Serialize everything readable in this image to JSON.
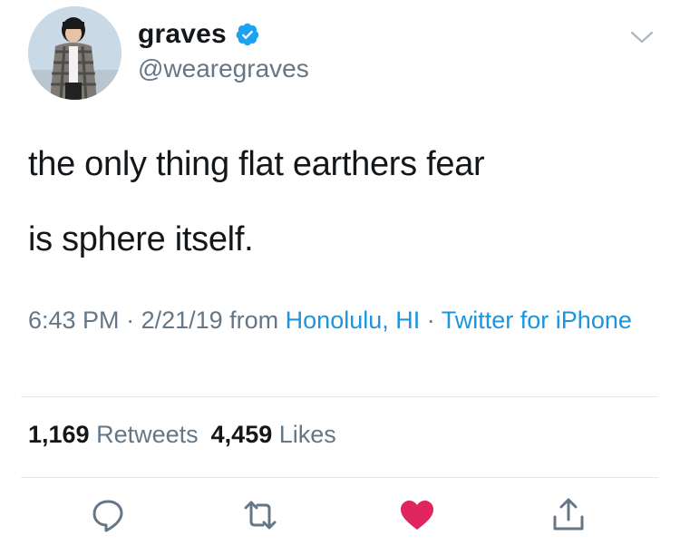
{
  "user": {
    "display_name": "graves",
    "handle": "@wearegraves",
    "verified_icon": "verified-badge-icon",
    "avatar_icon": "user-avatar"
  },
  "tweet": {
    "line1": "the only thing flat earthers fear",
    "line2": "is sphere itself."
  },
  "meta": {
    "time": "6:43 PM",
    "separator": " · ",
    "date": "2/21/19",
    "from_text": " from ",
    "location": "Honolulu, HI",
    "client": "Twitter for iPhone"
  },
  "stats": {
    "retweets_count": "1,169",
    "retweets_label": "Retweets",
    "likes_count": "4,459",
    "likes_label": "Likes"
  },
  "actions": {
    "reply_icon": "reply-icon",
    "retweet_icon": "retweet-icon",
    "like_icon": "heart-icon",
    "share_icon": "share-icon"
  },
  "colors": {
    "link": "#1b95e0",
    "secondary": "#657786",
    "like": "#e0245e",
    "verified": "#1da1f2"
  }
}
